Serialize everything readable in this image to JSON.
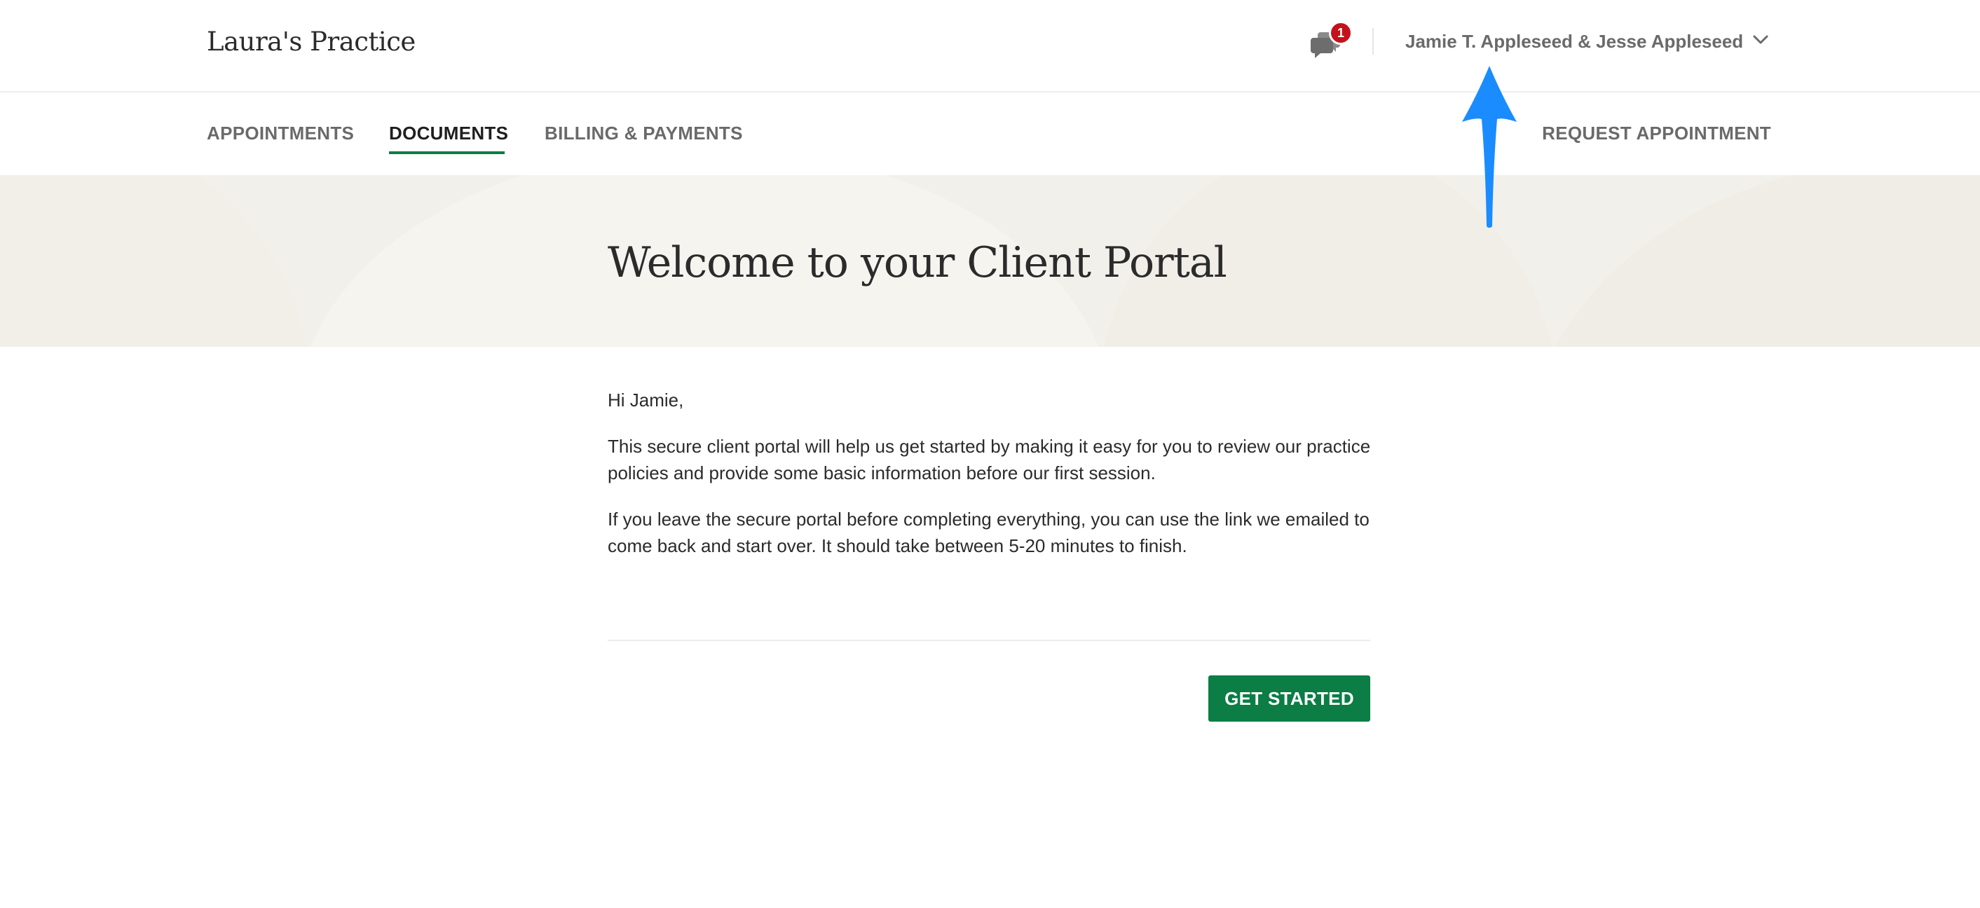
{
  "header": {
    "practice_name": "Laura's Practice",
    "messages_badge_count": "1",
    "user_menu_label": "Jamie T. Appleseed & Jesse Appleseed"
  },
  "nav": {
    "tabs": [
      {
        "label": "APPOINTMENTS",
        "active": false
      },
      {
        "label": "DOCUMENTS",
        "active": true
      },
      {
        "label": "BILLING & PAYMENTS",
        "active": false
      }
    ],
    "request_appointment": "REQUEST APPOINTMENT"
  },
  "hero": {
    "title": "Welcome to your Client Portal"
  },
  "body": {
    "greeting": "Hi Jamie,",
    "paragraph_1": "This secure client portal will help us get started by making it easy for you to review our practice policies and provide some basic information before our first session.",
    "paragraph_2": "If you leave the secure portal before completing everything, you can use the link we emailed to come back and start over. It should take between 5-20 minutes to finish."
  },
  "actions": {
    "get_started": "GET STARTED"
  },
  "colors": {
    "accent_green": "#0b7d45",
    "badge_red": "#c4121b",
    "hero_background": "#f2f0ea",
    "annotation_arrow": "#1a8cff"
  },
  "icons": {
    "messages": "chat-bubbles-icon",
    "user_menu": "chevron-down-icon",
    "annotation": "arrow-up-icon"
  }
}
